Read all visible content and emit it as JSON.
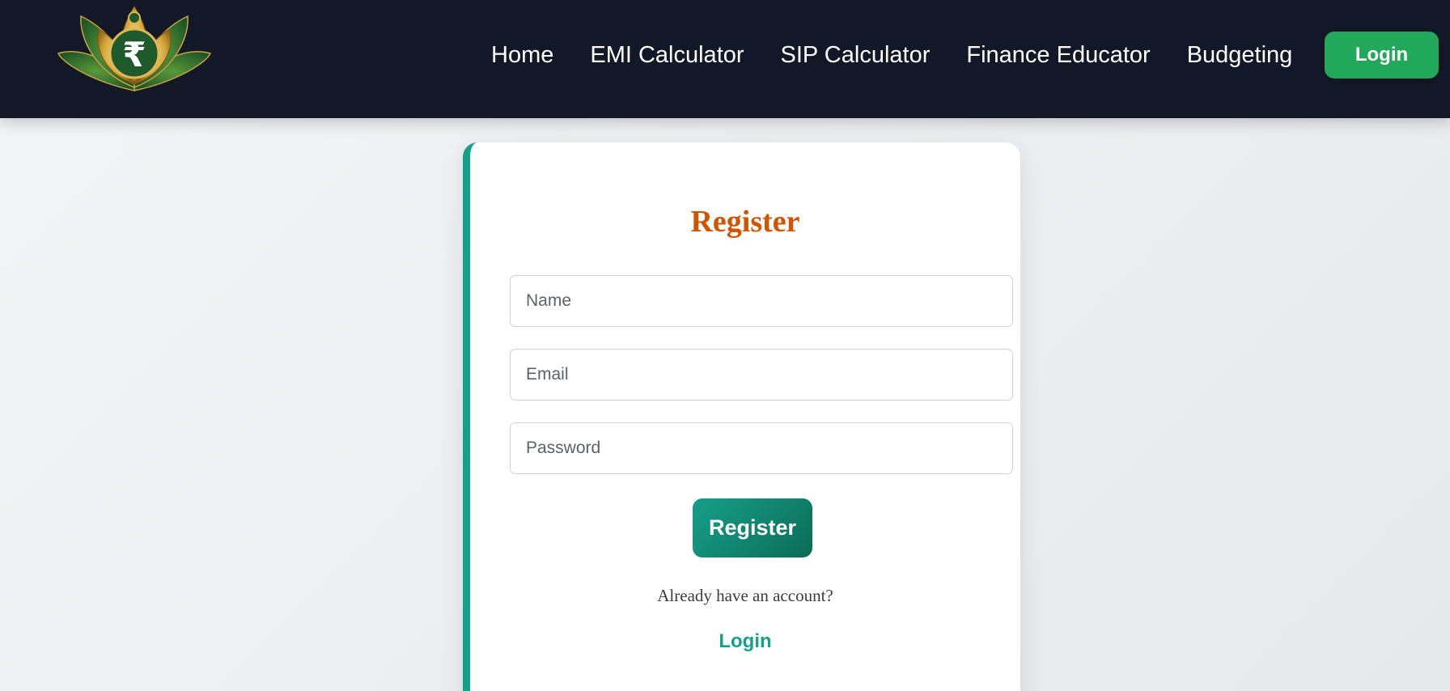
{
  "brand": {
    "logo_icon": "rupee-lotus-logo",
    "colors": {
      "navbar": "#121827",
      "accent": "#16a08a",
      "login_button": "#22a85a",
      "title": "#d35400"
    }
  },
  "nav": {
    "links": [
      "Home",
      "EMI Calculator",
      "SIP Calculator",
      "Finance Educator",
      "Budgeting"
    ],
    "login_label": "Login"
  },
  "register": {
    "title": "Register",
    "name_placeholder": "Name",
    "email_placeholder": "Email",
    "password_placeholder": "Password",
    "submit_label": "Register",
    "already_text": "Already have an account?",
    "login_link": "Login"
  }
}
